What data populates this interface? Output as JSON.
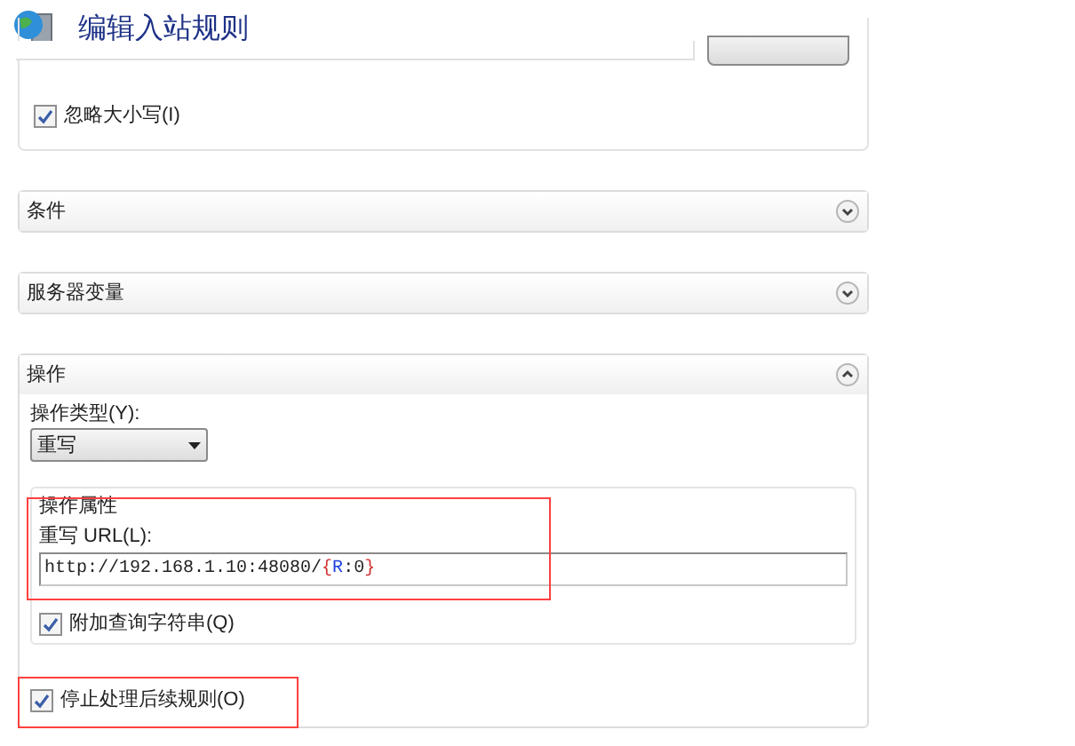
{
  "header": {
    "title": "编辑入站规则"
  },
  "top_panel": {
    "ignore_case": {
      "label": "忽略大小写(I)",
      "checked": true
    }
  },
  "sections": [
    {
      "title": "条件",
      "expanded": false
    },
    {
      "title": "服务器变量",
      "expanded": false
    },
    {
      "title": "操作",
      "expanded": true
    }
  ],
  "action": {
    "type_label": "操作类型(Y):",
    "type_value": "重写",
    "properties": {
      "title": "操作属性",
      "url_label": "重写 URL(L):",
      "url_segments": [
        {
          "text": "http://192.168.1.10:48080/",
          "kind": "plain"
        },
        {
          "text": "{",
          "kind": "brace"
        },
        {
          "text": "R",
          "kind": "var"
        },
        {
          "text": ":0",
          "kind": "plain"
        },
        {
          "text": "}",
          "kind": "brace"
        }
      ],
      "append_query": {
        "label": "附加查询字符串(Q)",
        "checked": true
      }
    },
    "stop_processing": {
      "label": "停止处理后续规则(O)",
      "checked": true
    }
  }
}
